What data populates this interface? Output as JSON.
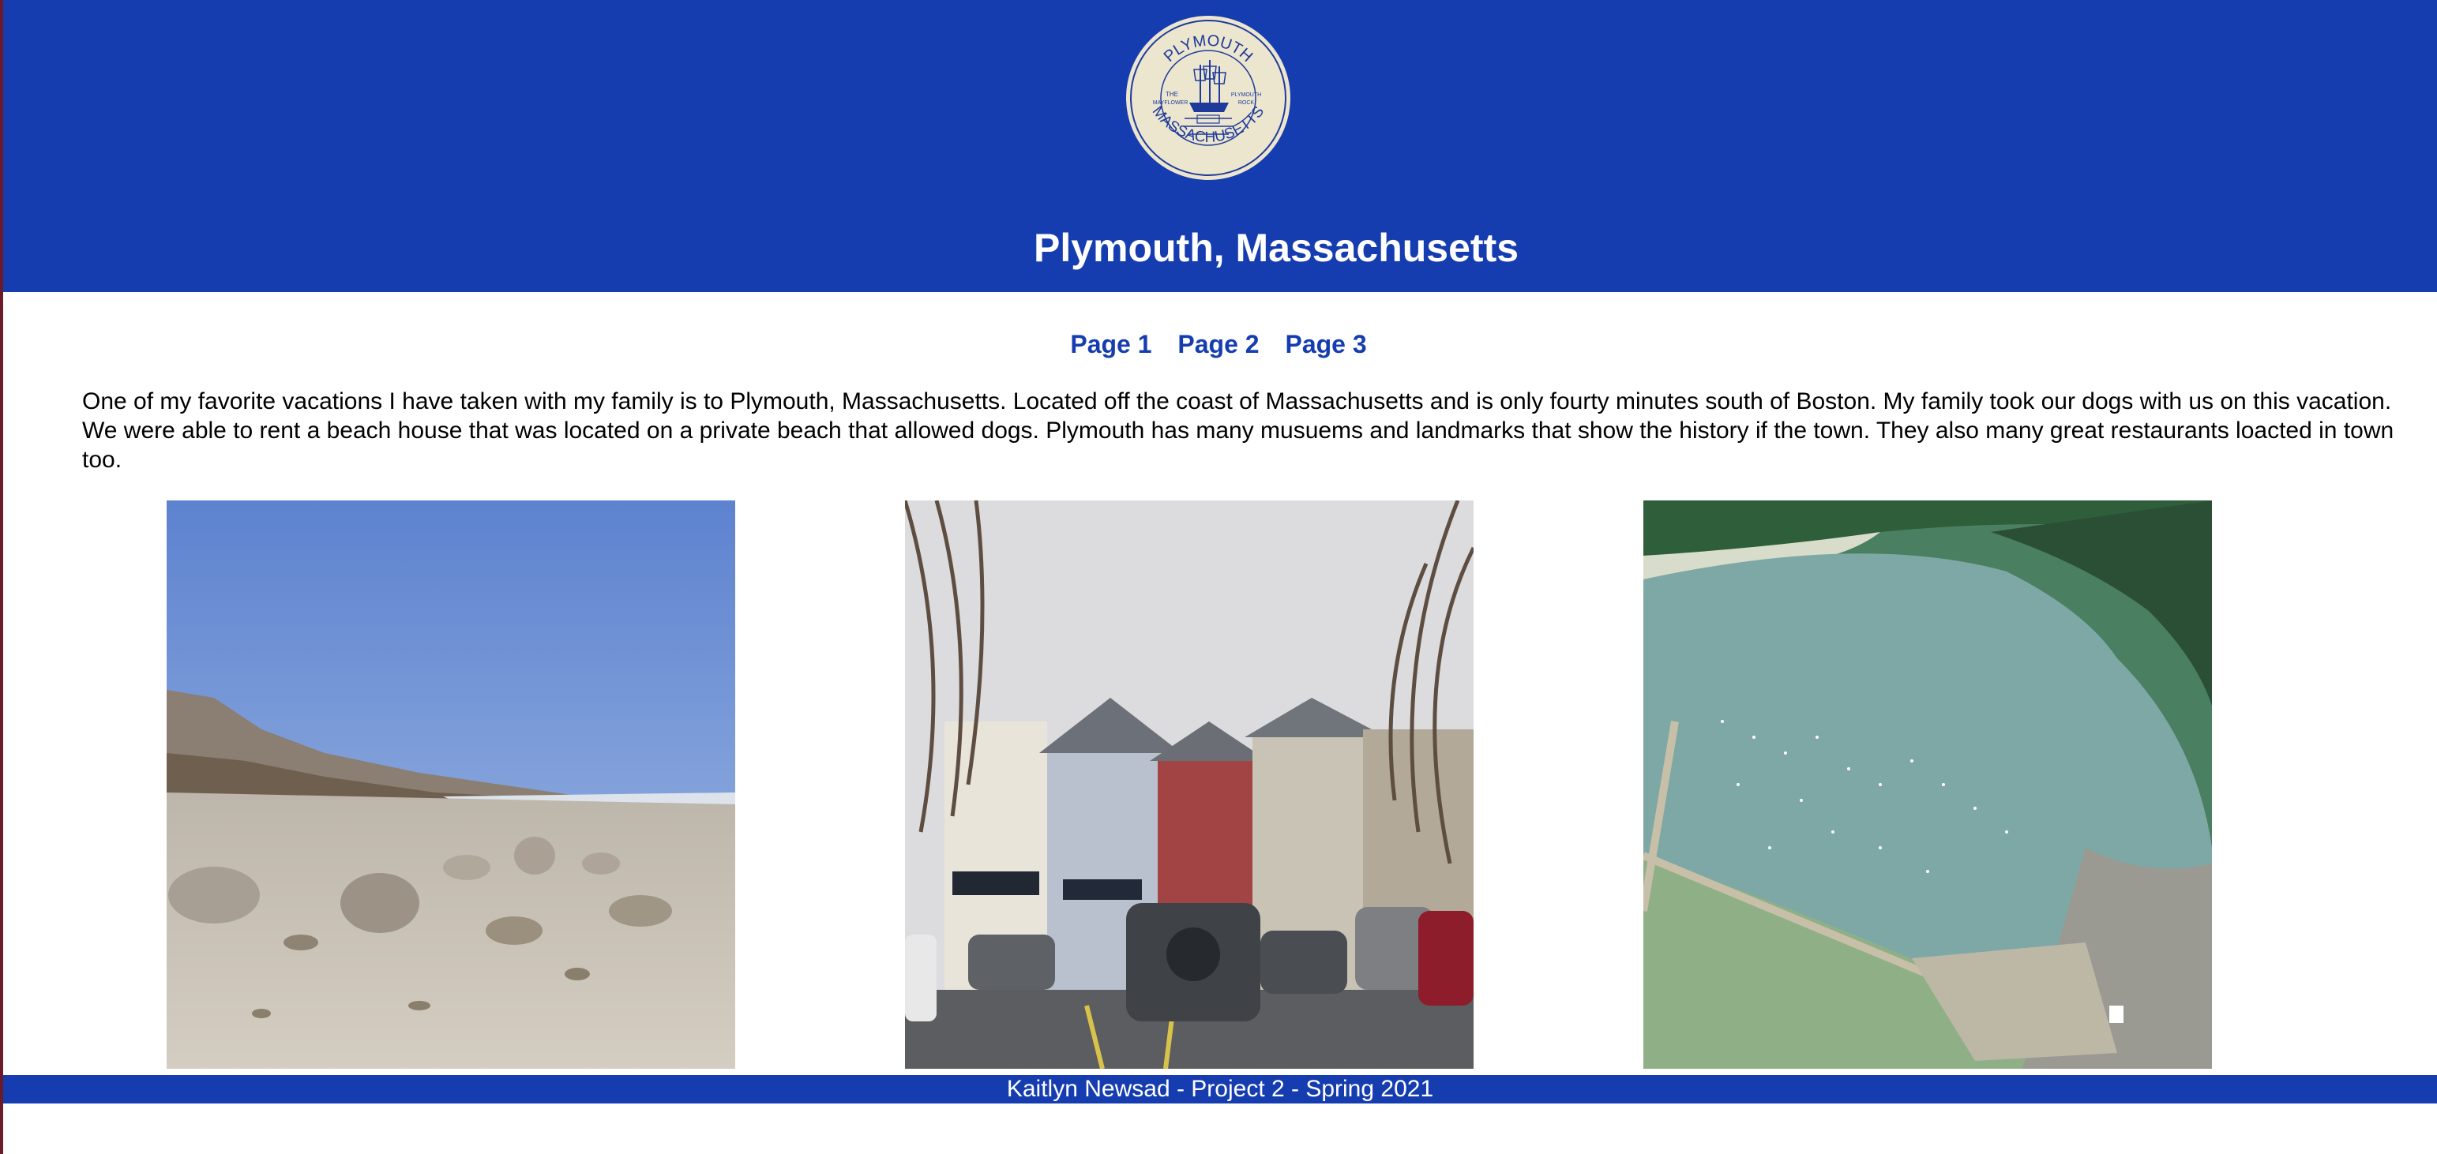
{
  "header": {
    "title": "Plymouth, Massachusetts",
    "seal": {
      "top_text": "PLYMOUTH",
      "bottom_text": "MASSACHUSETTS",
      "left_text": "THE MAYFLOWER",
      "right_text": "PLYMOUTH ROCK"
    }
  },
  "nav": {
    "links": [
      {
        "label": "Page 1"
      },
      {
        "label": "Page 2"
      },
      {
        "label": "Page 3"
      }
    ]
  },
  "intro": "One of my favorite vacations I have taken with my family is to Plymouth, Massachusetts. Located off the coast of Massachusetts and is only fourty minutes south of Boston. My family took our dogs with us on this vacation. We were able to rent a beach house that was located on a private beach that allowed dogs. Plymouth has many musuems and landmarks that show the history if the town. They also many great restaurants loacted in town too.",
  "photos": [
    {
      "name": "beach-photo"
    },
    {
      "name": "town-street-photo"
    },
    {
      "name": "harbor-aerial-photo"
    }
  ],
  "footer": "Kaitlyn Newsad - Project 2 - Spring 2021",
  "colors": {
    "brand_blue": "#163db0",
    "link_blue": "#163db0",
    "left_edge": "#6b1a2a"
  }
}
